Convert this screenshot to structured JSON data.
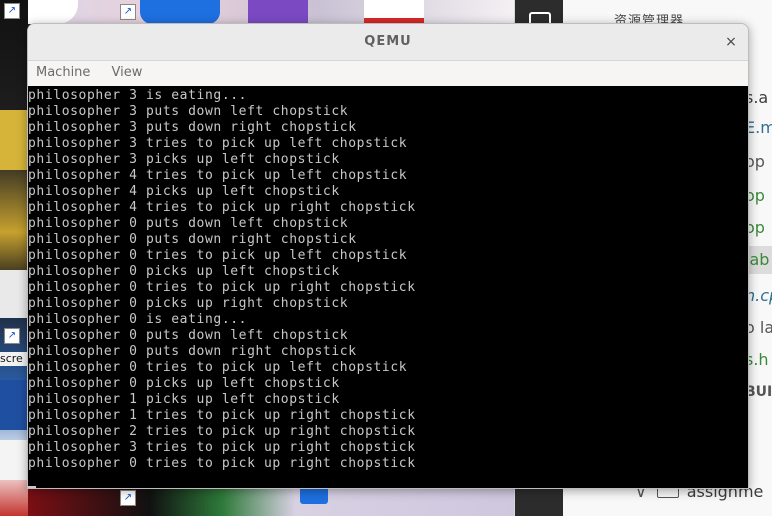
{
  "window": {
    "title": "QEMU",
    "close_glyph": "×",
    "menu": [
      "Machine",
      "View"
    ]
  },
  "console_lines": [
    "philosopher 3 is eating...",
    "philosopher 3 puts down left chopstick",
    "philosopher 3 puts down right chopstick",
    "philosopher 3 tries to pick up left chopstick",
    "philosopher 3 picks up left chopstick",
    "philosopher 4 tries to pick up left chopstick",
    "philosopher 4 picks up left chopstick",
    "philosopher 4 tries to pick up right chopstick",
    "philosopher 0 puts down left chopstick",
    "philosopher 0 puts down right chopstick",
    "philosopher 0 tries to pick up left chopstick",
    "philosopher 0 picks up left chopstick",
    "philosopher 0 tries to pick up right chopstick",
    "philosopher 0 picks up right chopstick",
    "philosopher 0 is eating...",
    "philosopher 0 puts down left chopstick",
    "philosopher 0 puts down right chopstick",
    "philosopher 0 tries to pick up left chopstick",
    "philosopher 0 picks up left chopstick",
    "philosopher 1 picks up left chopstick",
    "philosopher 1 tries to pick up right chopstick",
    "philosopher 2 tries to pick up right chopstick",
    "philosopher 3 tries to pick up right chopstick",
    "philosopher 0 tries to pick up right chopstick"
  ],
  "editor": {
    "explorer_title": "资源管理器",
    "files": [
      {
        "text": "s.a",
        "color": "#3c3c3c"
      },
      {
        "text": "E.m",
        "color": "#2f6f8f"
      },
      {
        "text": "op",
        "color": "#555555"
      },
      {
        "text": "op",
        "color": "#3a8a3a"
      },
      {
        "text": "op",
        "color": "#3a8a3a"
      },
      {
        "text": "lab",
        "color": "#3a8a3a"
      },
      {
        "text": "n.cp",
        "color": "#2f6f8f"
      },
      {
        "text": "o la",
        "color": "#555555"
      },
      {
        "text": "s.h",
        "color": "#3a8a3a"
      },
      {
        "text": "BUI",
        "color": "#555555"
      }
    ],
    "bottom_folder": "assignme",
    "selected_index": 5
  },
  "desktop": {
    "left_label_fragment": "scre"
  }
}
